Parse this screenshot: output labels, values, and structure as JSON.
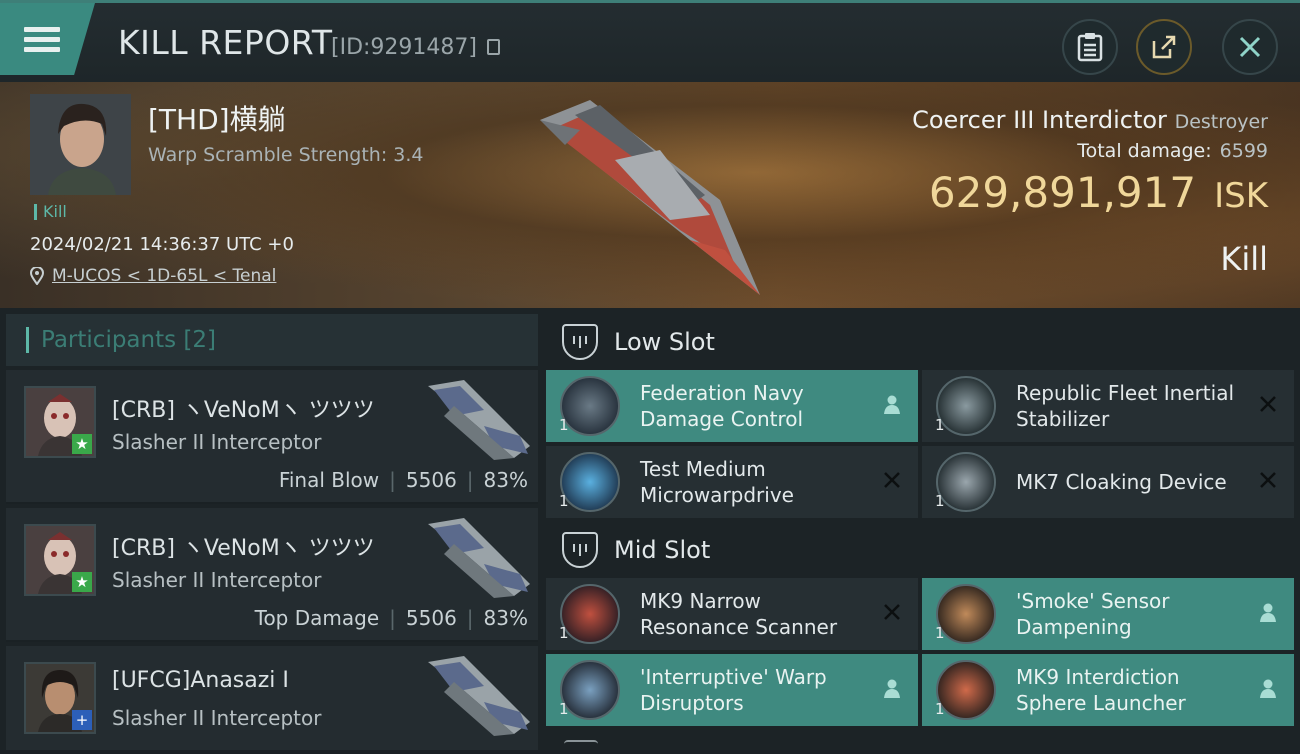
{
  "header": {
    "title": "KILL REPORT",
    "report_id": "[ID:9291487]"
  },
  "victim": {
    "name": "[THD]横躺",
    "warp_scramble": "Warp Scramble Strength: 3.4",
    "tag": "Kill",
    "timestamp": "2024/02/21 14:36:37 UTC +0",
    "location": "M-UCOS < 1D-65L < Tenal",
    "ship_name": "Coercer III Interdictor",
    "ship_class": "Destroyer",
    "total_damage_label": "Total damage:",
    "total_damage": "6599",
    "isk_value": "629,891,917",
    "isk_unit": "ISK",
    "result": "Kill"
  },
  "participants": {
    "label": "Participants [2]",
    "rows": [
      {
        "name": "[CRB] ヽVeNoMヽ ツツツ",
        "ship": "Slasher II Interceptor",
        "role": "Final Blow",
        "damage": "5506",
        "percent": "83%",
        "badge_color": "#3aa84a",
        "badge_icon": "star-icon"
      },
      {
        "name": "[CRB] ヽVeNoMヽ ツツツ",
        "ship": "Slasher II Interceptor",
        "role": "Top Damage",
        "damage": "5506",
        "percent": "83%",
        "badge_color": "#3aa84a",
        "badge_icon": "star-icon"
      },
      {
        "name": "[UFCG]Anasazi I",
        "ship": "Slasher II Interceptor",
        "role": "",
        "damage": "",
        "percent": "",
        "badge_color": "#2c5fb8",
        "badge_icon": "plus-icon"
      }
    ]
  },
  "slots": {
    "low": {
      "label": "Low Slot",
      "modules": [
        {
          "name": "Federation Navy Damage Control",
          "qty": "1",
          "state": "dropped",
          "flag_icon": "person-icon"
        },
        {
          "name": "Republic Fleet Inertial Stabilizer",
          "qty": "1",
          "state": "destroyed",
          "flag_icon": "x-icon"
        },
        {
          "name": "Test Medium Microwarpdrive",
          "qty": "1",
          "state": "destroyed",
          "flag_icon": "x-icon"
        },
        {
          "name": "MK7 Cloaking Device",
          "qty": "1",
          "state": "destroyed",
          "flag_icon": "x-icon"
        }
      ]
    },
    "mid": {
      "label": "Mid Slot",
      "modules": [
        {
          "name": "MK9 Narrow Resonance Scanner",
          "qty": "1",
          "state": "destroyed",
          "flag_icon": "x-icon"
        },
        {
          "name": "'Smoke' Sensor Dampening",
          "qty": "1",
          "state": "dropped",
          "flag_icon": "person-icon"
        },
        {
          "name": "'Interruptive' Warp Disruptors",
          "qty": "1",
          "state": "dropped",
          "flag_icon": "person-icon"
        },
        {
          "name": "MK9 Interdiction Sphere Launcher",
          "qty": "1",
          "state": "dropped",
          "flag_icon": "person-icon"
        }
      ]
    }
  },
  "colors": {
    "accent": "#3f8a80",
    "isk": "#f0d79a",
    "panel": "#262f33"
  }
}
